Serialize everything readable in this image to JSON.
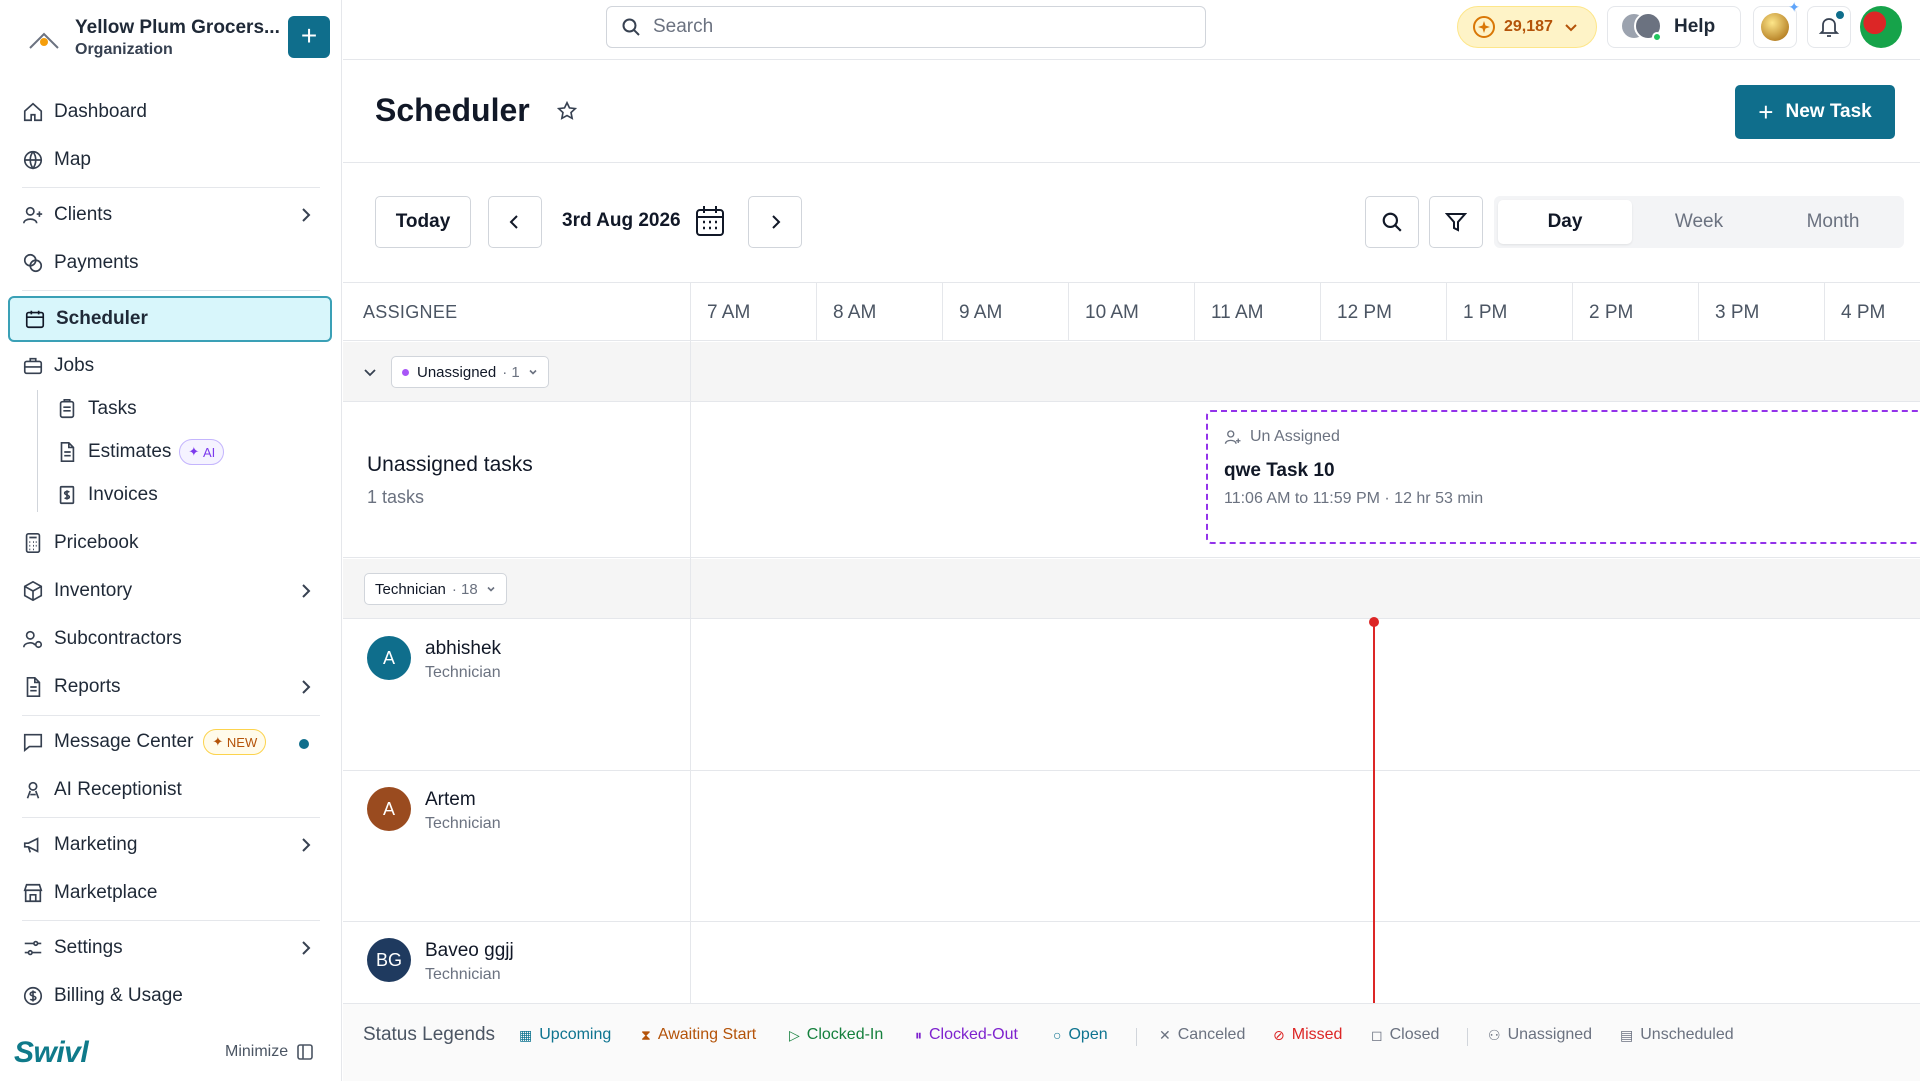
{
  "org": {
    "name": "Yellow Plum Grocers...",
    "type": "Organization"
  },
  "sidebar": {
    "items": [
      {
        "label": "Dashboard"
      },
      {
        "label": "Map"
      },
      {
        "label": "Clients"
      },
      {
        "label": "Payments"
      },
      {
        "label": "Scheduler"
      },
      {
        "label": "Jobs"
      },
      {
        "label": "Tasks"
      },
      {
        "label": "Estimates",
        "badge": "AI"
      },
      {
        "label": "Invoices"
      },
      {
        "label": "Pricebook"
      },
      {
        "label": "Inventory"
      },
      {
        "label": "Subcontractors"
      },
      {
        "label": "Reports"
      },
      {
        "label": "Message Center",
        "badge": "NEW"
      },
      {
        "label": "AI Receptionist"
      },
      {
        "label": "Marketing"
      },
      {
        "label": "Marketplace"
      },
      {
        "label": "Settings"
      },
      {
        "label": "Billing & Usage"
      }
    ],
    "brand": "Swivl",
    "minimize_label": "Minimize"
  },
  "topbar": {
    "search_placeholder": "Search",
    "credits": "29,187",
    "help_label": "Help"
  },
  "page": {
    "title": "Scheduler",
    "new_task_label": "New Task"
  },
  "toolbar": {
    "today_label": "Today",
    "date": "3rd Aug 2026",
    "views": [
      "Day",
      "Week",
      "Month"
    ],
    "active_view": "Day"
  },
  "grid": {
    "assignee_header": "ASSIGNEE",
    "hours": [
      "7 AM",
      "8 AM",
      "9 AM",
      "10 AM",
      "11 AM",
      "12 PM",
      "1 PM",
      "2 PM",
      "3 PM",
      "4 PM"
    ],
    "unassigned_group": {
      "label": "Unassigned",
      "count": "· 1"
    },
    "unassigned_row": {
      "title": "Unassigned tasks",
      "subtitle": "1 tasks"
    },
    "task": {
      "status": "Un Assigned",
      "title": "qwe Task 10",
      "time": "11:06 AM to 11:59 PM · 12 hr 53 min"
    },
    "technician_group": {
      "label": "Technician",
      "count": "· 18"
    },
    "technicians": [
      {
        "initials": "A",
        "name": "abhishek",
        "role": "Technician",
        "color": "#0f6e8c"
      },
      {
        "initials": "A",
        "name": "Artem",
        "role": "Technician",
        "color": "#9a4b1f"
      },
      {
        "initials": "BG",
        "name": "Baveo ggjj",
        "role": "Technician",
        "color": "#1f3a5f"
      }
    ]
  },
  "legend": {
    "title": "Status Legends",
    "items": [
      {
        "label": "Upcoming",
        "color": "#0e7490"
      },
      {
        "label": "Awaiting Start",
        "color": "#b45309"
      },
      {
        "label": "Clocked-In",
        "color": "#15803d"
      },
      {
        "label": "Clocked-Out",
        "color": "#7e22ce"
      },
      {
        "label": "Open",
        "color": "#0e7490"
      },
      {
        "label": "Canceled",
        "color": "#6b7280"
      },
      {
        "label": "Missed",
        "color": "#dc2626"
      },
      {
        "label": "Closed",
        "color": "#6b7280"
      },
      {
        "label": "Unassigned",
        "color": "#6b7280"
      },
      {
        "label": "Unscheduled",
        "color": "#6b7280"
      }
    ]
  }
}
